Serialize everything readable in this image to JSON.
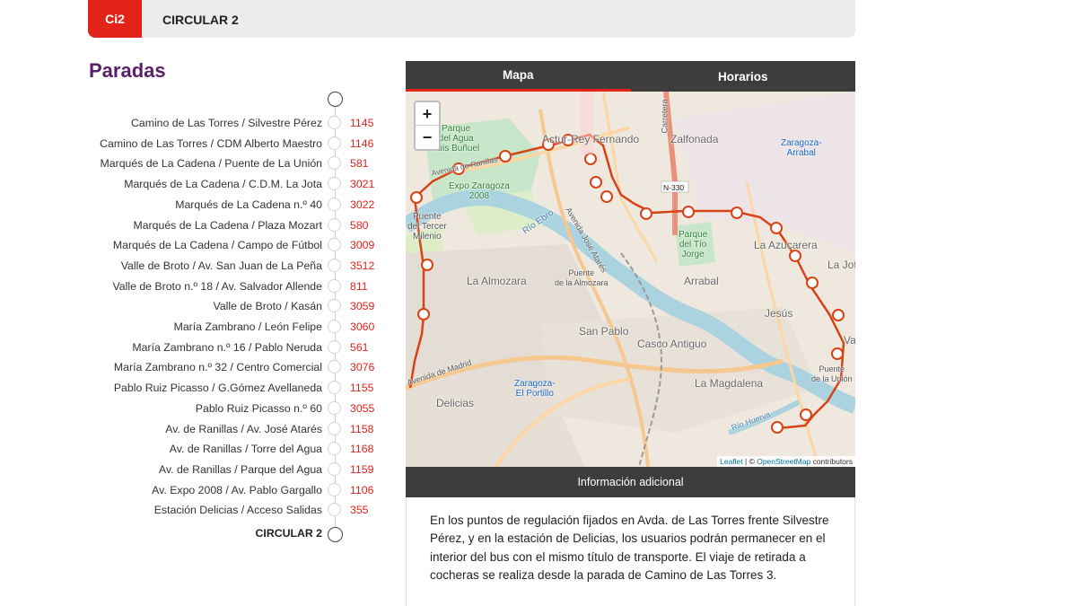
{
  "header": {
    "route_code": "Ci2",
    "route_name": "CIRCULAR 2"
  },
  "paradas": {
    "title": "Paradas",
    "stops": [
      {
        "name": "Camino de Las Torres / Silvestre Pérez",
        "code": "1145"
      },
      {
        "name": "Camino de Las Torres / CDM Alberto Maestro",
        "code": "1146"
      },
      {
        "name": "Marqués de La Cadena / Puente de La Unión",
        "code": "581"
      },
      {
        "name": "Marqués de La Cadena / C.D.M. La Jota",
        "code": "3021"
      },
      {
        "name": "Marqués de La Cadena n.º 40",
        "code": "3022"
      },
      {
        "name": "Marqués de La Cadena / Plaza Mozart",
        "code": "580"
      },
      {
        "name": "Marqués de La Cadena / Campo de Fútbol",
        "code": "3009"
      },
      {
        "name": "Valle de Broto / Av. San Juan de La Peña",
        "code": "3512"
      },
      {
        "name": "Valle de Broto n.º 18 / Av. Salvador Allende",
        "code": "811"
      },
      {
        "name": "Valle de Broto / Kasán",
        "code": "3059"
      },
      {
        "name": "María Zambrano / León Felipe",
        "code": "3060"
      },
      {
        "name": "María Zambrano n.º 16 / Pablo Neruda",
        "code": "561"
      },
      {
        "name": "María Zambrano n.º 32 / Centro Comercial",
        "code": "3076"
      },
      {
        "name": "Pablo Ruiz Picasso / G.Gómez Avellaneda",
        "code": "1155"
      },
      {
        "name": "Pablo Ruiz Picasso n.º 60",
        "code": "3055"
      },
      {
        "name": "Av. de Ranillas / Av. José Atarés",
        "code": "1158"
      },
      {
        "name": "Av. de Ranillas / Torre del Agua",
        "code": "1168"
      },
      {
        "name": "Av. de Ranillas / Parque del Agua",
        "code": "1159"
      },
      {
        "name": "Av. Expo 2008 / Av. Pablo Gargallo",
        "code": "1106"
      },
      {
        "name": "Estación Delicias / Acceso Salidas",
        "code": "355"
      }
    ],
    "end_label": "CIRCULAR 2"
  },
  "tabs": {
    "map_label": "Mapa",
    "schedule_label": "Horarios",
    "active": "Mapa"
  },
  "map": {
    "zoom_in": "+",
    "zoom_out": "−",
    "attribution_leaflet": "Leaflet",
    "attribution_sep": " | © ",
    "attribution_osm": "OpenStreetMap",
    "attribution_tail": " contributors",
    "labels": {
      "parque_agua": "Parque\ndel Agua\nLuis Buñuel",
      "expo": "Expo Zaragoza\n2008",
      "puente_tercer_milenio": "Puente\ndel Tercer\nMilenio",
      "rio_ebro": "Río Ebro",
      "avenida_jose_atares": "Avenida José Atarés",
      "la_almozara": "La Almozara",
      "puente_almozara": "Puente\nde la Almozara",
      "arrabal": "Arrabal",
      "jesus": "Jesús",
      "san_pablo": "San Pablo",
      "casco_antiguo": "Casco Antiguo",
      "la_magdalena": "La Magdalena",
      "delicias": "Delicias",
      "zaragoza_portillo": "Zaragoza-\nEl Portillo",
      "zalfonada": "Zalfonada",
      "zaragoza_arrabal": "Zaragoza-\nArrabal",
      "la_azucarera": "La Azucarera",
      "la_jota": "La Jota",
      "parque_tio_jorge": "Parque\ndel Tío\nJorge",
      "puente_union": "Puente\nde la Unión",
      "avenida_madrid": "Avenida de Madrid",
      "rio_huerva": "Río Huerva",
      "n330": "N-330",
      "actur": "Actur-Rey Fernando",
      "carretera": "Carretera",
      "avenida_ranillas": "Avenida de Ranillas",
      "vade": "Vade"
    }
  },
  "info": {
    "header": "Información adicional",
    "text": "En los puntos de regulación fijados en Avda. de Las Torres frente Silvestre Pérez, y en la estación de Delicias, los usuarios podrán permanecer en el interior del bus con el mismo título de transporte. El viaje de retirada a cocheras se realiza desde la parada de Camino de Las Torres 3."
  },
  "colors": {
    "accent_red": "#e2231a",
    "title_purple": "#5b2168",
    "tab_bg": "#3d3d3d",
    "route_line": "#d84315",
    "river": "#aad3df",
    "park": "#c8e6c9"
  }
}
